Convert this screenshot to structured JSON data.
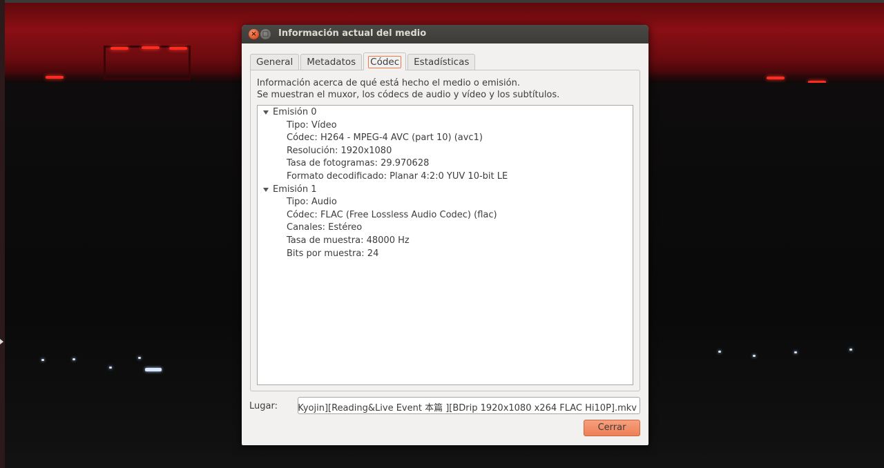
{
  "window": {
    "title": "Información actual del medio"
  },
  "tabs": [
    {
      "label": "General",
      "active": false
    },
    {
      "label": "Metadatos",
      "active": false
    },
    {
      "label": "Códec",
      "active": true
    },
    {
      "label": "Estadísticas",
      "active": false
    }
  ],
  "codec_panel": {
    "info_line1": "Información acerca de qué está hecho el medio o emisión.",
    "info_line2": "Se muestran el muxor, los códecs de audio y vídeo y los subtítulos.",
    "streams": [
      {
        "label": "Emisión 0",
        "expanded": true,
        "properties": [
          "Tipo: Vídeo",
          "Códec: H264 - MPEG-4 AVC (part 10) (avc1)",
          "Resolución: 1920x1080",
          "Tasa de fotogramas: 29.970628",
          "Formato decodificado: Planar 4:2:0 YUV 10-bit LE"
        ]
      },
      {
        "label": "Emisión 1",
        "expanded": true,
        "properties": [
          "Tipo: Audio",
          "Códec: FLAC (Free Lossless Audio Codec) (flac)",
          "Canales: Estéreo",
          "Tasa de muestra: 48000 Hz",
          "Bits por muestra: 24"
        ]
      }
    ]
  },
  "location": {
    "label": "Lugar:",
    "value": "Kyojin][Reading&Live Event 本篇 ][BDrip 1920x1080 x264 FLAC Hi10P].mkv"
  },
  "buttons": {
    "close_label": "Cerrar"
  },
  "colors": {
    "accent": "#f07746",
    "titlebar": "#3c3b37",
    "dialog_bg": "#f2f1f0"
  }
}
